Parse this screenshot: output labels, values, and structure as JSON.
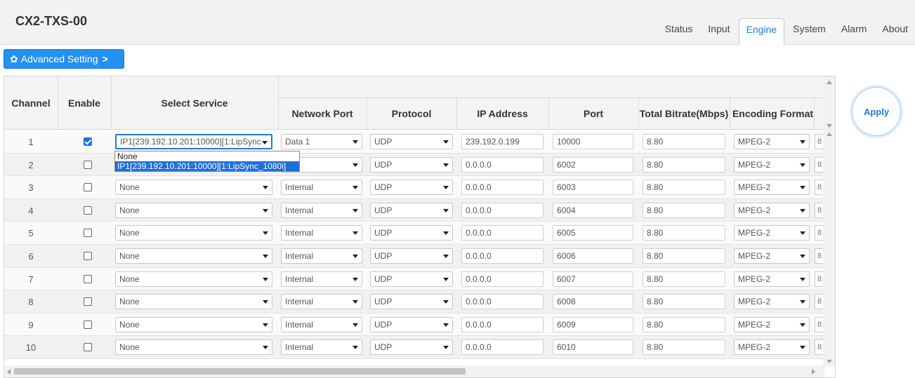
{
  "app": {
    "title": "CX2-TXS-00"
  },
  "nav": {
    "tabs": [
      {
        "label": "Status"
      },
      {
        "label": "Input"
      },
      {
        "label": "Engine",
        "active": true
      },
      {
        "label": "System"
      },
      {
        "label": "Alarm"
      },
      {
        "label": "About"
      }
    ]
  },
  "toolbar": {
    "advanced_label": "Advanced Setting",
    "advanced_icon": "gear-icon",
    "advanced_chevron": "chevron-right-icon"
  },
  "table": {
    "headers": {
      "channel": "Channel",
      "enable": "Enable",
      "select_service": "Select Service",
      "network_port": "Network Port",
      "protocol": "Protocol",
      "ip_address": "IP Address",
      "port": "Port",
      "total_bitrate": "Total Bitrate(Mbps)",
      "encoding_format": "Encoding Format"
    },
    "rows": [
      {
        "channel": "1",
        "enable": true,
        "service": "IP1[239.192.10.201:10000][1:LipSync",
        "network_port": "Data 1",
        "protocol": "UDP",
        "ip": "239.192.0.199",
        "port": "10000",
        "bitrate": "8.80",
        "encoding": "MPEG-2",
        "clip": "8"
      },
      {
        "channel": "2",
        "enable": false,
        "service": "",
        "network_port": "nal",
        "protocol": "UDP",
        "ip": "0.0.0.0",
        "port": "6002",
        "bitrate": "8.80",
        "encoding": "MPEG-2",
        "clip": "8"
      },
      {
        "channel": "3",
        "enable": false,
        "service": "None",
        "network_port": "Internal",
        "protocol": "UDP",
        "ip": "0.0.0.0",
        "port": "6003",
        "bitrate": "8.80",
        "encoding": "MPEG-2",
        "clip": "8"
      },
      {
        "channel": "4",
        "enable": false,
        "service": "None",
        "network_port": "Internal",
        "protocol": "UDP",
        "ip": "0.0.0.0",
        "port": "6004",
        "bitrate": "8.80",
        "encoding": "MPEG-2",
        "clip": "8"
      },
      {
        "channel": "5",
        "enable": false,
        "service": "None",
        "network_port": "Internal",
        "protocol": "UDP",
        "ip": "0.0.0.0",
        "port": "6005",
        "bitrate": "8.80",
        "encoding": "MPEG-2",
        "clip": "8"
      },
      {
        "channel": "6",
        "enable": false,
        "service": "None",
        "network_port": "Internal",
        "protocol": "UDP",
        "ip": "0.0.0.0",
        "port": "6006",
        "bitrate": "8.80",
        "encoding": "MPEG-2",
        "clip": "8"
      },
      {
        "channel": "7",
        "enable": false,
        "service": "None",
        "network_port": "Internal",
        "protocol": "UDP",
        "ip": "0.0.0.0",
        "port": "6007",
        "bitrate": "8.80",
        "encoding": "MPEG-2",
        "clip": "8"
      },
      {
        "channel": "8",
        "enable": false,
        "service": "None",
        "network_port": "Internal",
        "protocol": "UDP",
        "ip": "0.0.0.0",
        "port": "6008",
        "bitrate": "8.80",
        "encoding": "MPEG-2",
        "clip": "8"
      },
      {
        "channel": "9",
        "enable": false,
        "service": "None",
        "network_port": "Internal",
        "protocol": "UDP",
        "ip": "0.0.0.0",
        "port": "6009",
        "bitrate": "8.80",
        "encoding": "MPEG-2",
        "clip": "8"
      },
      {
        "channel": "10",
        "enable": false,
        "service": "None",
        "network_port": "Internal",
        "protocol": "UDP",
        "ip": "0.0.0.0",
        "port": "6010",
        "bitrate": "8.80",
        "encoding": "MPEG-2",
        "clip": "8"
      }
    ]
  },
  "dropdown": {
    "options": [
      "None",
      "IP1[239.192.10.201:10000][1:LipSync_1080i]"
    ],
    "highlighted": 1
  },
  "apply": {
    "label": "Apply"
  },
  "colors": {
    "accent": "#1f7be0",
    "button": "#2490ef",
    "highlight": "#1e6fd9"
  }
}
